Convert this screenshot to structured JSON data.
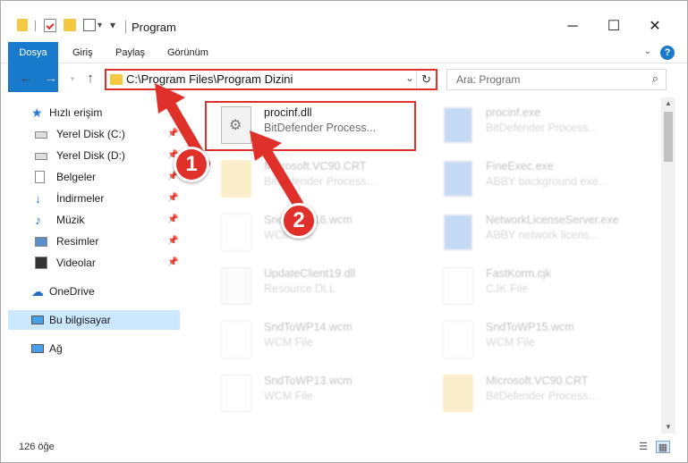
{
  "window": {
    "title": "Program",
    "minimize_icon": "minimize-icon",
    "maximize_icon": "maximize-icon",
    "close_icon": "close-icon"
  },
  "ribbon": {
    "tabs": [
      "Dosya",
      "Giriş",
      "Paylaş",
      "Görünüm"
    ],
    "help": "?"
  },
  "address": {
    "path": "C:\\Program Files\\Program Dizini"
  },
  "search": {
    "placeholder": "Ara: Program"
  },
  "sidebar": {
    "quick_access": "Hızlı erişim",
    "items": [
      {
        "label": "Yerel Disk (C:)",
        "icon": "drive-icon"
      },
      {
        "label": "Yerel Disk (D:)",
        "icon": "drive-icon"
      },
      {
        "label": "Belgeler",
        "icon": "documents-icon"
      },
      {
        "label": "İndirmeler",
        "icon": "download-icon"
      },
      {
        "label": "Müzik",
        "icon": "music-icon"
      },
      {
        "label": "Resimler",
        "icon": "pictures-icon"
      },
      {
        "label": "Videolar",
        "icon": "video-icon"
      }
    ],
    "onedrive": "OneDrive",
    "this_pc": "Bu bilgisayar",
    "network": "Ağ"
  },
  "files": [
    {
      "name": "procinf.dll",
      "desc": "BitDefender Process...",
      "icon": "dll-gear-icon"
    },
    {
      "name": "procinf.exe",
      "desc": "BitDefender Process...",
      "icon": "exe-icon"
    },
    {
      "name": "Microsoft.VC90.CRT",
      "desc": "BitDefender Process...",
      "icon": "folder-icon"
    },
    {
      "name": "FineExec.exe",
      "desc": "ABBY background exe...",
      "icon": "exe-icon"
    },
    {
      "name": "SndToWP16.wcm",
      "desc": "WCM File",
      "icon": "file-icon"
    },
    {
      "name": "NetworkLicenseServer.exe",
      "desc": "ABBY network licens...",
      "icon": "exe-icon"
    },
    {
      "name": "UpdateClient19.dll",
      "desc": "Resource DLL",
      "icon": "dll-gear-icon"
    },
    {
      "name": "FastKorm.cjk",
      "desc": "CJK File",
      "icon": "file-icon"
    },
    {
      "name": "SndToWP14.wcm",
      "desc": "WCM File",
      "icon": "file-icon"
    },
    {
      "name": "SndToWP15.wcm",
      "desc": "WCM File",
      "icon": "file-icon"
    },
    {
      "name": "SndToWP13.wcm",
      "desc": "WCM File",
      "icon": "file-icon"
    },
    {
      "name": "Microsoft.VC90.CRT",
      "desc": "BitDefender Process...",
      "icon": "folder-icon"
    }
  ],
  "status": {
    "count": "126 öğe"
  },
  "annotations": {
    "step1": "1",
    "step2": "2"
  }
}
